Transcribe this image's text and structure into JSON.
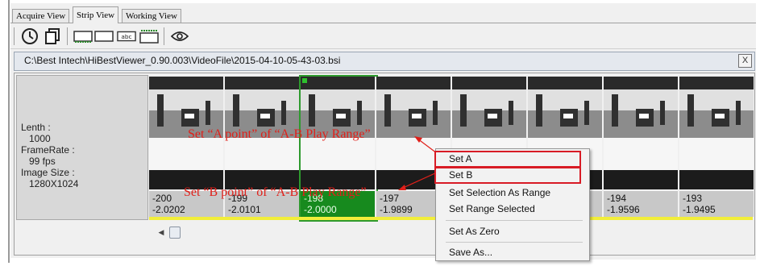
{
  "tabs": [
    {
      "label": "Acquire View",
      "active": false
    },
    {
      "label": "Strip View",
      "active": true
    },
    {
      "label": "Working View",
      "active": false
    }
  ],
  "toolbar": {
    "icons": [
      "clock-icon",
      "copy-icon",
      "strip-filmstrip-icon",
      "strip-blank-icon",
      "abc-label-icon",
      "strip-window-icon",
      "eye-icon"
    ]
  },
  "path": {
    "text": "C:\\Best Intech\\HiBestViewer_0.90.003\\VideoFile\\2015-04-10-05-43-03.bsi",
    "close_label": "X"
  },
  "info": {
    "length_label": "Lenth :",
    "length_value": "1000",
    "framerate_label": "FrameRate :",
    "framerate_value": "99 fps",
    "imagesize_label": "Image Size :",
    "imagesize_value": "1280X1024"
  },
  "frames": [
    {
      "index": "-200",
      "value": "-2.0202",
      "selected": false
    },
    {
      "index": "-199",
      "value": "-2.0101",
      "selected": false
    },
    {
      "index": "-198",
      "value": "-2.0000",
      "selected": true
    },
    {
      "index": "-197",
      "value": "-1.9899",
      "selected": false
    },
    {
      "index": "",
      "value": "",
      "selected": false
    },
    {
      "index": "",
      "value": "",
      "selected": false
    },
    {
      "index": "-194",
      "value": "-1.9596",
      "selected": false
    },
    {
      "index": "-193",
      "value": "-1.9495",
      "selected": false
    }
  ],
  "annotations": {
    "a_point": "Set “A point” of “A-B Play Range”",
    "b_point": "Set “B point” of “A-B Play Range”"
  },
  "context_menu": {
    "items": [
      "Set A",
      "Set B",
      "Set Selection As Range",
      "Set Range Selected",
      "Set As Zero",
      "Save As..."
    ]
  },
  "colors": {
    "selected_frame": "#178a1e",
    "annotation": "#e0201a",
    "highlight_box": "#d81b25",
    "range_line": "#f2ee3a"
  }
}
